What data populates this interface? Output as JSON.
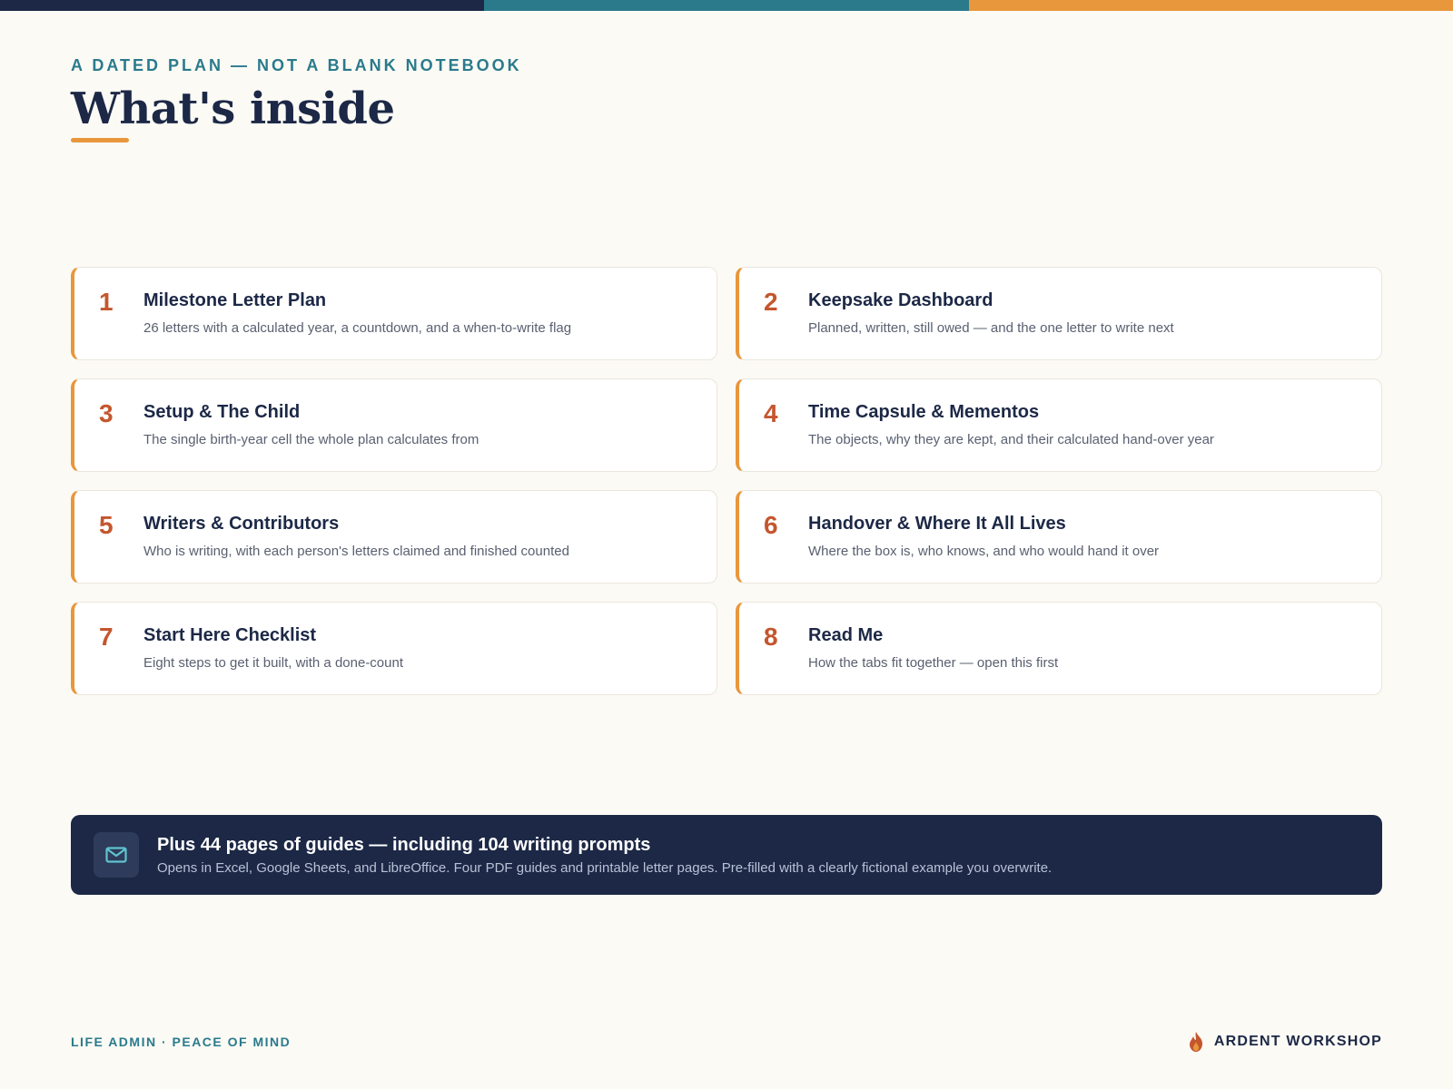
{
  "colors": {
    "navy": "#1c2846",
    "teal": "#2a7a8c",
    "orange": "#e8973c",
    "number": "#c4562e",
    "background": "#fbfaf5"
  },
  "header": {
    "eyebrow": "A DATED PLAN — NOT A BLANK NOTEBOOK",
    "title": "What's inside"
  },
  "cards": [
    {
      "num": "1",
      "title": "Milestone Letter Plan",
      "desc": "26 letters with a calculated year, a countdown, and a when-to-write flag"
    },
    {
      "num": "2",
      "title": "Keepsake Dashboard",
      "desc": "Planned, written, still owed — and the one letter to write next"
    },
    {
      "num": "3",
      "title": "Setup & The Child",
      "desc": "The single birth-year cell the whole plan calculates from"
    },
    {
      "num": "4",
      "title": "Time Capsule & Mementos",
      "desc": "The objects, why they are kept, and their calculated hand-over year"
    },
    {
      "num": "5",
      "title": "Writers & Contributors",
      "desc": "Who is writing, with each person's letters claimed and finished counted"
    },
    {
      "num": "6",
      "title": "Handover & Where It All Lives",
      "desc": "Where the box is, who knows, and who would hand it over"
    },
    {
      "num": "7",
      "title": "Start Here Checklist",
      "desc": "Eight steps to get it built, with a done-count"
    },
    {
      "num": "8",
      "title": "Read Me",
      "desc": "How the tabs fit together — open this first"
    }
  ],
  "banner": {
    "icon": "envelope-icon",
    "title": "Plus 44 pages of guides — including 104 writing prompts",
    "subtitle": "Opens in Excel, Google Sheets, and LibreOffice. Four PDF guides and printable letter pages. Pre-filled with a clearly fictional example you overwrite."
  },
  "footer": {
    "tagline": "LIFE ADMIN · PEACE OF MIND",
    "brand": "ARDENT WORKSHOP",
    "brand_icon": "flame-icon"
  }
}
